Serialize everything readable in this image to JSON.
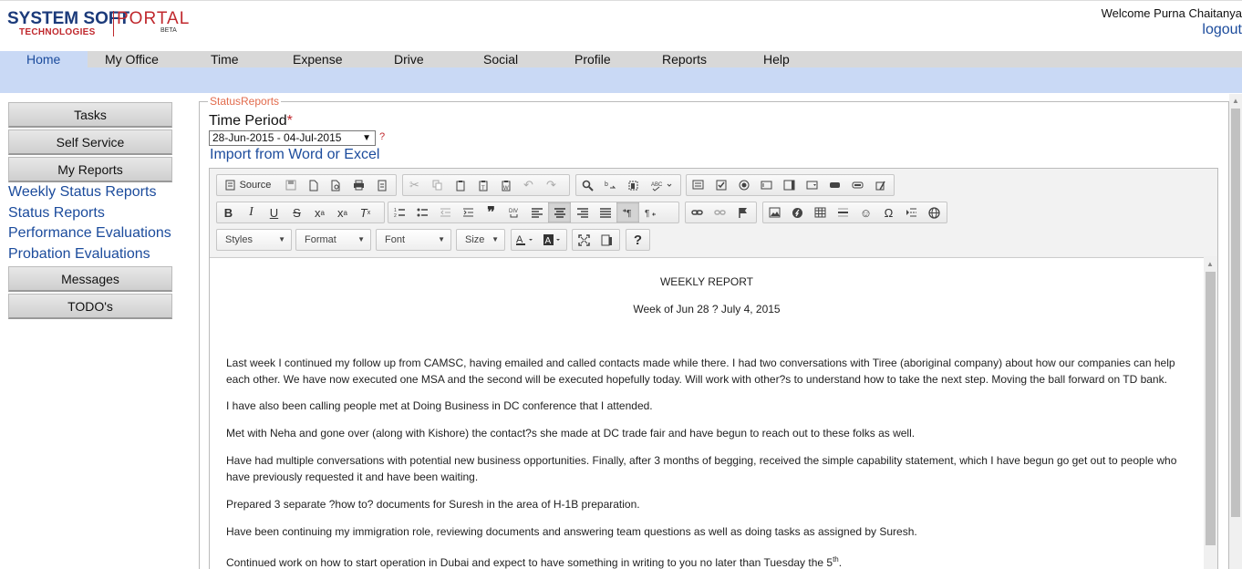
{
  "header": {
    "logo_main": "SYSTEM SOFT",
    "logo_tech": "TECHNOLOGIES",
    "logo_portal": "PORTAL",
    "logo_beta": "BETA",
    "welcome": "Welcome Purna Chaitanya",
    "logout": "logout"
  },
  "nav": {
    "items": [
      {
        "label": "Home"
      },
      {
        "label": "My Office"
      },
      {
        "label": "Time"
      },
      {
        "label": "Expense"
      },
      {
        "label": "Drive"
      },
      {
        "label": "Social"
      },
      {
        "label": "Profile"
      },
      {
        "label": "Reports"
      },
      {
        "label": "Help"
      }
    ]
  },
  "sidebar": {
    "tasks": "Tasks",
    "self_service": "Self Service",
    "my_reports": "My Reports",
    "links": [
      {
        "label": "Weekly Status Reports"
      },
      {
        "label": "Status Reports"
      },
      {
        "label": "Performance Evaluations"
      },
      {
        "label": "Probation Evaluations"
      }
    ],
    "messages": "Messages",
    "todos": "TODO's"
  },
  "form": {
    "legend": "StatusReports",
    "time_period_label": "Time Period",
    "required_mark": "*",
    "time_period_value": "28-Jun-2015 - 04-Jul-2015",
    "help_mark": "?",
    "import_link": "Import from Word or Excel"
  },
  "editor": {
    "source_label": "Source",
    "styles_label": "Styles",
    "format_label": "Format",
    "font_label": "Font",
    "size_label": "Size",
    "help_label": "?",
    "content": {
      "heading": "WEEKLY REPORT",
      "subheading": "Week of Jun 28 ? July 4, 2015",
      "paragraphs": [
        "Last week I continued my follow up from CAMSC, having emailed and called contacts made while there. I had two conversations with Tiree (aboriginal company) about how our companies can help each other. We have now executed one MSA and the second will be executed hopefully today. Will work with other?s to understand how to take the next step. Moving the ball forward on TD bank.",
        "I have also been calling people met at Doing Business in DC conference that I attended.",
        "Met with Neha and gone over (along with Kishore) the contact?s she made at DC trade fair and have begun to reach out to these folks as well.",
        "Have had multiple conversations with potential new business opportunities. Finally, after 3 months of begging, received the simple capability statement, which I have begun go get out to people who have previously requested it and have been waiting.",
        "Prepared 3 separate ?how to? documents for Suresh in the area of H-1B preparation.",
        "Have been continuing my immigration role, reviewing documents and answering team questions as well as doing tasks as assigned by Suresh."
      ],
      "last_paragraph": "Continued work on how to start operation in Dubai and expect to have something in writing to you no later than Tuesday the 5",
      "last_paragraph_sup": "th",
      "last_paragraph_end": "."
    }
  }
}
